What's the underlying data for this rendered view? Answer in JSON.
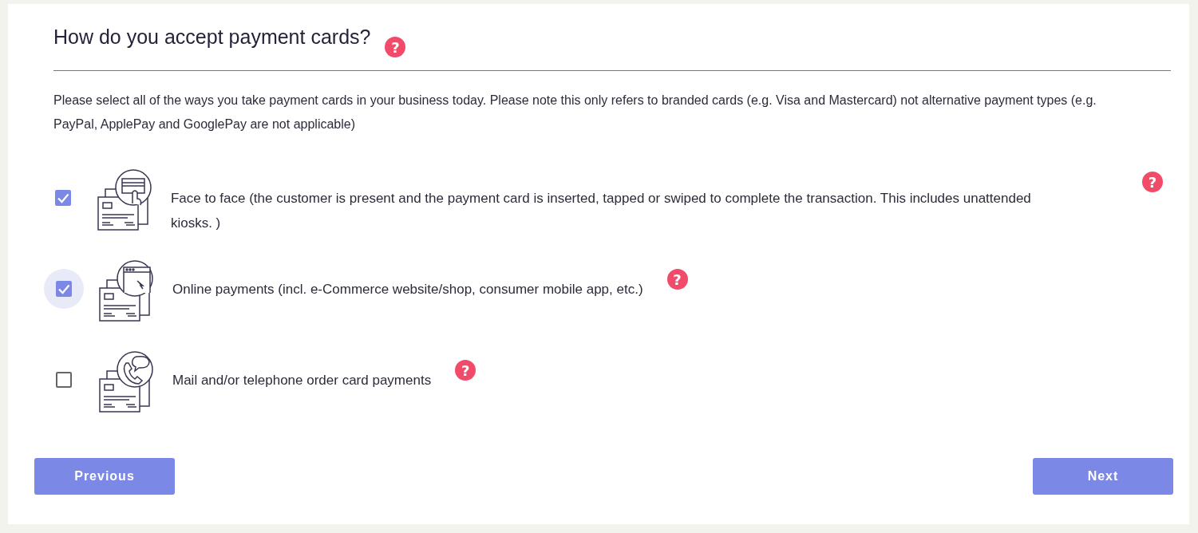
{
  "heading": {
    "title": "How do you accept payment cards?",
    "help": "?"
  },
  "intro": "Please select all of the ways you take payment cards in your business today. Please note this only refers to branded cards (e.g. Visa and Mastercard) not alternative payment types (e.g. PayPal, ApplePay and GooglePay are not applicable)",
  "options": [
    {
      "kind": "card",
      "label": "Face to face (the customer is present and the payment card is inserted, tapped or swiped to complete the transaction. This includes unattended kiosks. )",
      "checked": true,
      "focused": false,
      "help": "?"
    },
    {
      "kind": "browser",
      "label": "Online payments (incl. e-Commerce website/shop, consumer mobile app, etc.)",
      "checked": true,
      "focused": true,
      "help": "?"
    },
    {
      "kind": "phone",
      "label": "Mail and/or telephone order card payments",
      "checked": false,
      "focused": false,
      "help": "?"
    }
  ],
  "buttons": {
    "previous": "Previous",
    "next": "Next"
  }
}
